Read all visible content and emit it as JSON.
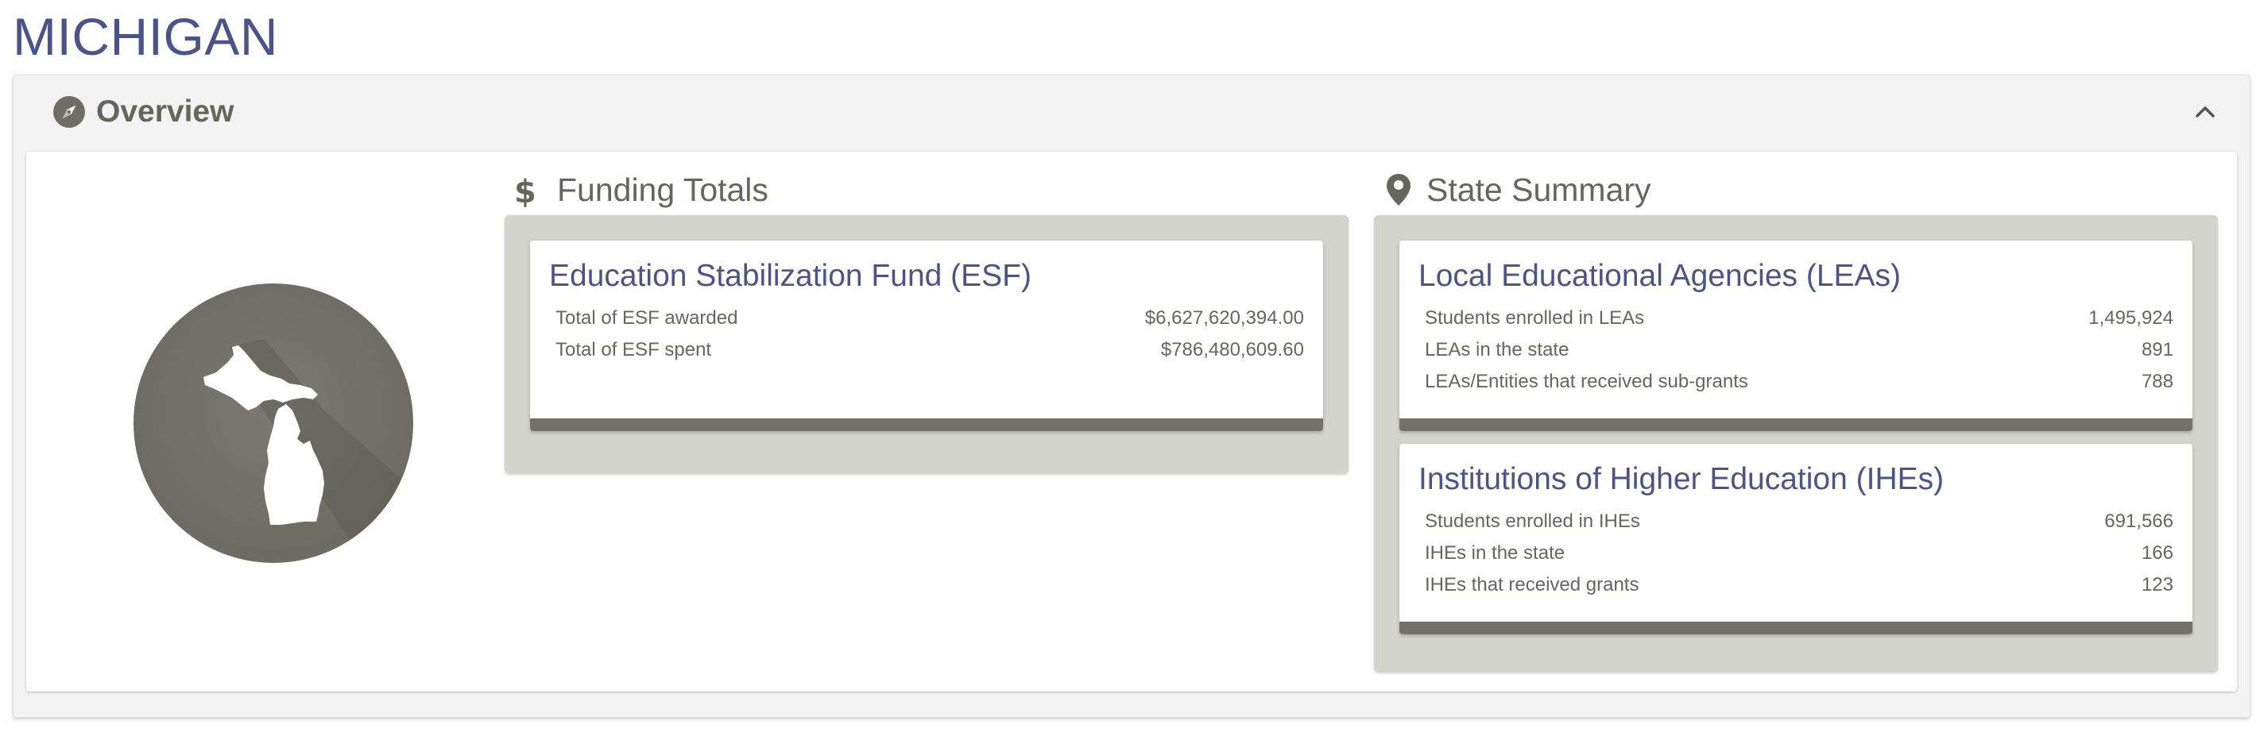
{
  "state_name": "MICHIGAN",
  "overview": {
    "label": "Overview",
    "icon": "compass-icon",
    "collapse_icon": "chevron-up-icon"
  },
  "funding": {
    "title": "Funding Totals",
    "icon": "dollar-icon",
    "esf": {
      "title": "Education Stabilization Fund (ESF)",
      "rows": [
        {
          "label": "Total of ESF awarded",
          "value": "$6,627,620,394.00"
        },
        {
          "label": "Total of ESF spent",
          "value": "$786,480,609.60"
        }
      ]
    }
  },
  "summary": {
    "title": "State Summary",
    "icon": "map-marker-icon",
    "leas": {
      "title": "Local Educational Agencies (LEAs)",
      "rows": [
        {
          "label": "Students enrolled in LEAs",
          "value": "1,495,924"
        },
        {
          "label": "LEAs in the state",
          "value": "891"
        },
        {
          "label": "LEAs/Entities that received sub-grants",
          "value": "788"
        }
      ]
    },
    "ihes": {
      "title": "Institutions of Higher Education (IHEs)",
      "rows": [
        {
          "label": "Students enrolled in IHEs",
          "value": "691,566"
        },
        {
          "label": "IHEs in the state",
          "value": "166"
        },
        {
          "label": "IHEs that received grants",
          "value": "123"
        }
      ]
    }
  },
  "colors": {
    "title_blue": "#4b5488",
    "badge_gray": "#6e6e66",
    "card_bar": "#72726b",
    "card_wrap": "#d4d4cf"
  }
}
